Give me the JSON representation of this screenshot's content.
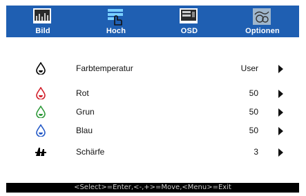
{
  "tabs": [
    {
      "label": "Bild",
      "icon": "picture-icon"
    },
    {
      "label": "Hoch",
      "icon": "advanced-icon"
    },
    {
      "label": "OSD",
      "icon": "osd-icon"
    },
    {
      "label": "Optionen",
      "icon": "options-icon"
    }
  ],
  "active_tab": "Hoch",
  "menu": {
    "rows": [
      {
        "label": "Farbtemperatur",
        "value": "User",
        "icon": "color-temperature-icon",
        "icon_color": "#000000"
      },
      {
        "label": "Rot",
        "value": "50",
        "icon": "red-drop-icon",
        "icon_color": "#d21f2a"
      },
      {
        "label": "Grun",
        "value": "50",
        "icon": "green-drop-icon",
        "icon_color": "#2f9a3a"
      },
      {
        "label": "Blau",
        "value": "50",
        "icon": "blue-drop-icon",
        "icon_color": "#2459c7"
      },
      {
        "label": "Schärfe",
        "value": "3",
        "icon": "sharpness-icon",
        "icon_color": "#000000"
      }
    ]
  },
  "status_bar": {
    "text": "<Select>=Enter,<-,+>=Move,<Menu>=Exit"
  },
  "colors": {
    "tab_bar": "#1f5fb2",
    "status_bar": "#000000"
  }
}
